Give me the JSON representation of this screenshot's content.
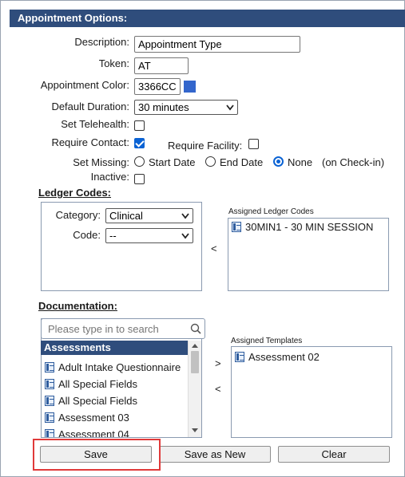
{
  "header": {
    "title": "Appointment Options:"
  },
  "form": {
    "description": {
      "label": "Description:",
      "value": "Appointment Type"
    },
    "token": {
      "label": "Token:",
      "value": "AT"
    },
    "color": {
      "label": "Appointment Color:",
      "value": "3366CC",
      "swatch": "#3366cc"
    },
    "default_duration": {
      "label": "Default Duration:",
      "value": "30 minutes"
    },
    "set_telehealth": {
      "label": "Set Telehealth:",
      "checked": false
    },
    "require_contact": {
      "label": "Require Contact:",
      "checked": true
    },
    "require_facility": {
      "label": "Require Facility:",
      "checked": false
    },
    "set_missing": {
      "label": "Set Missing:",
      "options": [
        "Start Date",
        "End Date",
        "None"
      ],
      "selected": "None",
      "suffix": "(on Check-in)"
    },
    "inactive": {
      "label": "Inactive:",
      "checked": false
    }
  },
  "ledger": {
    "title": "Ledger Codes:",
    "category_label": "Category:",
    "category_value": "Clinical",
    "code_label": "Code:",
    "code_value": "--",
    "move_left": "<",
    "assigned_title": "Assigned Ledger Codes",
    "assigned_items": [
      "30MIN1 - 30 MIN SESSION"
    ]
  },
  "documentation": {
    "title": "Documentation:",
    "search_placeholder": "Please type in to search",
    "group_header": "Assessments",
    "items": [
      "Adult Intake Questionnaire",
      "All Special Fields",
      "All Special Fields",
      "Assessment 03",
      "Assessment 04"
    ],
    "move_right": ">",
    "move_left": "<",
    "assigned_title": "Assigned Templates",
    "assigned_items": [
      "Assessment 02"
    ]
  },
  "buttons": {
    "save": "Save",
    "save_as_new": "Save as New",
    "clear": "Clear"
  },
  "colors": {
    "header_bg": "#2f4d7c",
    "accent": "#0b63d4",
    "highlight": "#e03a3a"
  }
}
